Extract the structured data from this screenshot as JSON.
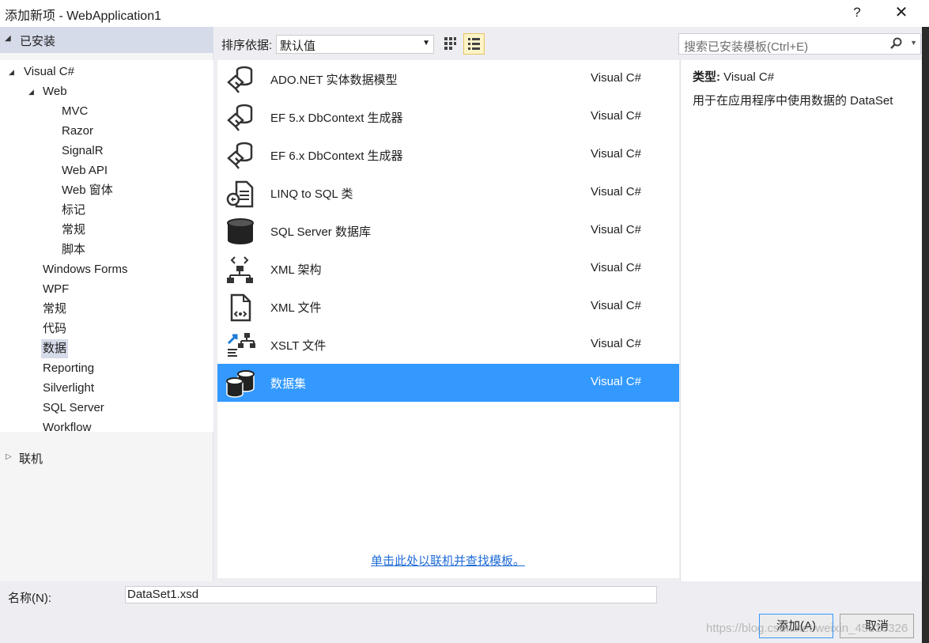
{
  "window": {
    "title": "添加新项 - WebApplication1",
    "help": "?",
    "close": "✕"
  },
  "sidebar": {
    "installed_label": "已安装",
    "tree": {
      "visual_csharp": "Visual C#",
      "web": "Web",
      "web_children": [
        "MVC",
        "Razor",
        "SignalR",
        "Web API",
        "Web 窗体",
        "标记",
        "常规",
        "脚本"
      ],
      "other": [
        "Windows Forms",
        "WPF",
        "常规",
        "代码",
        "数据",
        "Reporting",
        "Silverlight",
        "SQL Server",
        "Workflow"
      ],
      "selected": "数据"
    },
    "online_label": "联机"
  },
  "toolbar": {
    "sort_label": "排序依据:",
    "sort_value": "默认值",
    "search_placeholder": "搜索已安装模板(Ctrl+E)"
  },
  "templates": [
    {
      "name": "ADO.NET 实体数据模型",
      "lang": "Visual C#",
      "icon": "entity-model-icon"
    },
    {
      "name": "EF 5.x DbContext 生成器",
      "lang": "Visual C#",
      "icon": "dbcontext-generator-icon"
    },
    {
      "name": "EF 6.x DbContext 生成器",
      "lang": "Visual C#",
      "icon": "dbcontext-generator-icon"
    },
    {
      "name": "LINQ to SQL 类",
      "lang": "Visual C#",
      "icon": "linq-sql-icon"
    },
    {
      "name": "SQL Server 数据库",
      "lang": "Visual C#",
      "icon": "database-icon"
    },
    {
      "name": "XML 架构",
      "lang": "Visual C#",
      "icon": "xml-schema-icon"
    },
    {
      "name": "XML 文件",
      "lang": "Visual C#",
      "icon": "xml-file-icon"
    },
    {
      "name": "XSLT 文件",
      "lang": "Visual C#",
      "icon": "xslt-file-icon"
    },
    {
      "name": "数据集",
      "lang": "Visual C#",
      "icon": "dataset-icon",
      "selected": true
    }
  ],
  "online_link": "单击此处以联机并查找模板。",
  "details": {
    "type_label": "类型:",
    "type_value": "Visual C#",
    "description": "用于在应用程序中使用数据的 DataSet"
  },
  "footer": {
    "name_label": "名称(N):",
    "name_value": "DataSet1.xsd",
    "add_button": "添加(A)",
    "cancel_button": "取消"
  },
  "watermark": "https://blog.csdn.net/weixin_45310326",
  "colors": {
    "selection": "#3399ff",
    "sidebar_header": "#d6dbe9",
    "background": "#eeeef2"
  }
}
